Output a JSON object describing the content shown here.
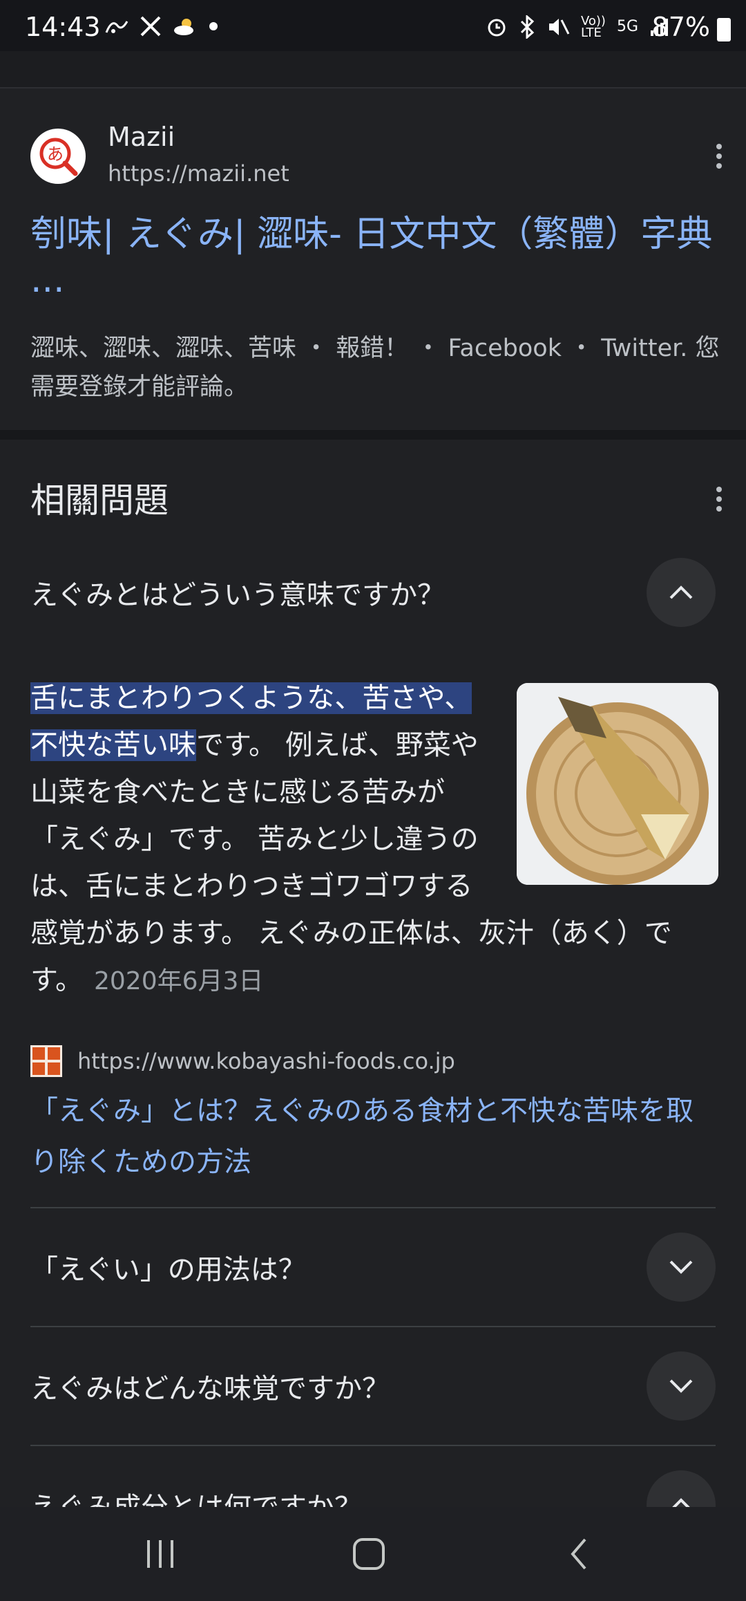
{
  "status_bar": {
    "time": "14:43",
    "left_icons": [
      "life360-icon",
      "x-app-icon",
      "weather-partly-cloudy-icon",
      "notification-dot-icon"
    ],
    "volte_label": "Vo))\nLTE",
    "network_label": "5G",
    "battery_label": "87%"
  },
  "result": {
    "site_name": "Mazii",
    "site_url": "https://mazii.net",
    "favicon_glyph": "あ",
    "title": "刳味| えぐみ| 澀味- 日文中文（繁體）字典 ...",
    "snippet": "澀味、澀味、澀味、苦味 ・ 報錯！ ・ Facebook ・ Twitter. 您需要登錄才能評論。"
  },
  "related": {
    "heading": "相關問題",
    "expanded_question": "えぐみとはどういう意味ですか？",
    "answer_highlight": "舌にまとわりつくような、苦さや、不快な苦い味",
    "answer_rest": "です。 例えば、野菜や山菜を食べたときに感じる苦みが「えぐみ」です。 苦みと少し違うのは、舌にまとわりつきゴワゴワする感覚があります。 えぐみの正体は、灰汁（あく）です。",
    "answer_date": "2020年6月3日",
    "source_url": "https://www.kobayashi-foods.co.jp",
    "source_title": "「えぐみ」とは？えぐみのある食材と不快な苦味を取り除くための方法",
    "questions": [
      "「えぐい」の用法は？",
      "えぐみはどんな味覚ですか？",
      "えぐみ成分とは何ですか？"
    ]
  },
  "colors": {
    "background": "#202124",
    "link": "#8ab4f8",
    "highlight": "#2d4480"
  }
}
